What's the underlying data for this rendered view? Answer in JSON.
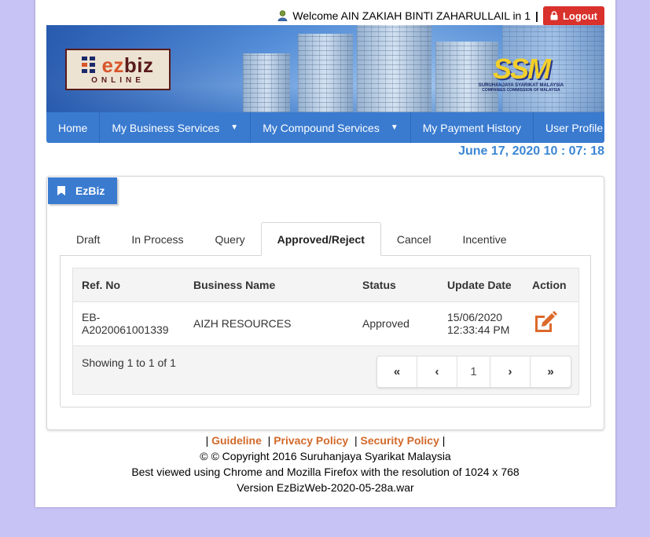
{
  "header": {
    "welcome_text": "Welcome AIN ZAKIAH BINTI ZAHARULLAIL in 1",
    "separator": "|",
    "logout_label": "Logout"
  },
  "banner": {
    "ezbiz_word_ez": "ez",
    "ezbiz_word_biz": "biz",
    "ezbiz_online": "ONLINE",
    "ssm_word": "SSM",
    "ssm_sub_1": "SURUHANJAYA SYARIKAT MALAYSIA",
    "ssm_sub_2": "COMPANIES COMMISSION OF MALAYSIA"
  },
  "nav": {
    "home": "Home",
    "business_services": "My Business Services",
    "compound_services": "My Compound Services",
    "payment_history": "My Payment History",
    "user_profile": "User Profile"
  },
  "datetime": "June 17, 2020 10 : 07: 18",
  "panel": {
    "title": "EzBiz",
    "tabs": [
      "Draft",
      "In Process",
      "Query",
      "Approved/Reject",
      "Cancel",
      "Incentive"
    ],
    "active_tab": "Approved/Reject"
  },
  "table": {
    "headers": {
      "ref_no": "Ref. No",
      "business_name": "Business Name",
      "status": "Status",
      "update_date": "Update Date",
      "action": "Action"
    },
    "rows": [
      {
        "ref_no_line1": "EB-",
        "ref_no_line2": "A2020061001339",
        "business_name": "AIZH RESOURCES",
        "status": "Approved",
        "date_line1": "15/06/2020",
        "date_line2": "12:33:44 PM"
      }
    ],
    "showing": "Showing 1 to 1 of 1"
  },
  "pagination": {
    "first": "«",
    "prev": "‹",
    "page": "1",
    "next": "›",
    "last": "»"
  },
  "footer": {
    "guideline": "Guideline",
    "privacy": "Privacy Policy",
    "security": "Security Policy",
    "copyright": "© © Copyright 2016 Suruhanjaya Syarikat Malaysia",
    "best_viewed": "Best viewed using Chrome and Mozilla Firefox with the resolution of 1024 x 768",
    "version": "Version EzBizWeb-2020-05-28a.war"
  },
  "colors": {
    "nav_blue": "#3a7bd0",
    "logout_red": "#d9312b",
    "link_orange": "#d2692a",
    "datetime_blue": "#3b86d4",
    "background": "#c8c3f5"
  },
  "icons": [
    "user-icon",
    "lock-icon",
    "bookmark-icon",
    "edit-icon",
    "chevron-down-icon"
  ]
}
